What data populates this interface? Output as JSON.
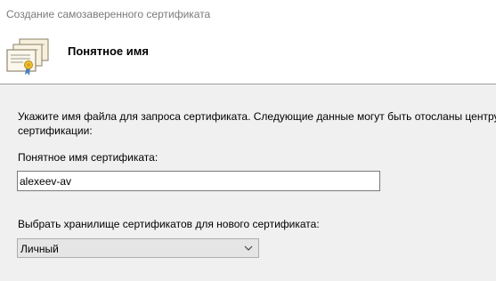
{
  "window": {
    "title": "Создание самозаверенного сертификата"
  },
  "header": {
    "title": "Понятное имя",
    "icon": "certificate-stack-icon"
  },
  "content": {
    "instruction_line1": "Укажите имя файла для запроса сертификата. Следующие данные могут быть отосланы центру",
    "instruction_line2": "сертификации:",
    "friendly_name_label": "Понятное имя сертификата:",
    "friendly_name_value": "alexeev-av",
    "store_label": "Выбрать хранилище сертификатов для нового сертификата:",
    "store_selected": "Личный"
  }
}
